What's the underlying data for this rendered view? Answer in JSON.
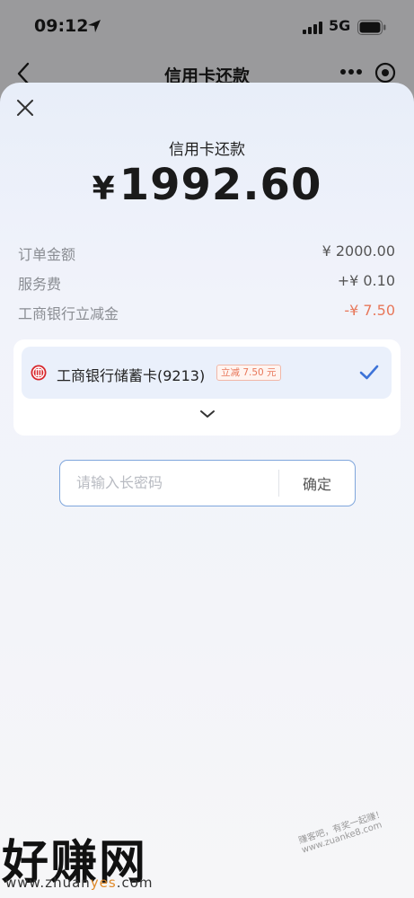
{
  "status_bar": {
    "time": "09:12",
    "network": "5G"
  },
  "header": {
    "title": "信用卡还款"
  },
  "sheet": {
    "title": "信用卡还款",
    "currency": "¥",
    "amount": "1992.60"
  },
  "fees": [
    {
      "label": "订单金额",
      "value": "¥ 2000.00",
      "type": "normal"
    },
    {
      "label": "服务费",
      "value": "+¥ 0.10",
      "type": "normal"
    },
    {
      "label": "工商银行立减金",
      "value": "-¥ 7.50",
      "type": "discount"
    }
  ],
  "payment_card": {
    "name": "工商银行储蓄卡(9213)",
    "promo": "立减 7.50 元",
    "selected": true
  },
  "password": {
    "placeholder": "请输入长密码",
    "value": "",
    "confirm_label": "确定"
  },
  "watermark": {
    "logo": "好赚网",
    "url_prefix": "www.zhuan",
    "url_highlight": "yes",
    "url_suffix": ".com",
    "slogan": "赚客吧，有奖一起赚！ www.zuanke8.com"
  },
  "colors": {
    "accent": "#3d73d8",
    "discount": "#e8775a",
    "border_focus": "#7fa6dc"
  },
  "icons": {
    "close": "close-icon",
    "bank": "icbc-logo-icon",
    "check": "check-icon",
    "chevron": "chevron-down-icon",
    "back": "back-arrow-icon",
    "more": "more-icon",
    "target": "target-icon"
  }
}
